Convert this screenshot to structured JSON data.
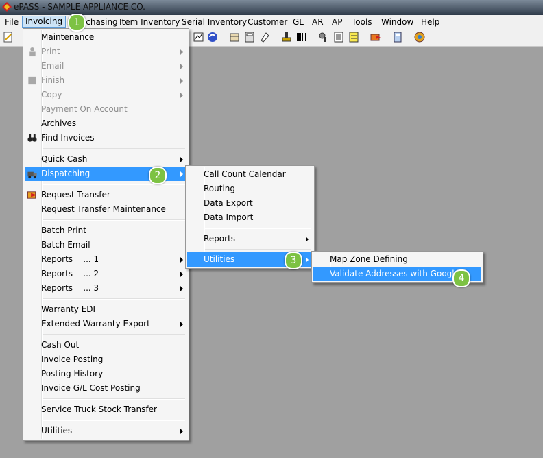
{
  "window": {
    "title": "ePASS  -  SAMPLE APPLIANCE CO."
  },
  "menubar": [
    "File",
    "Invoicing",
    "Purchasing",
    "Item Inventory",
    "Serial Inventory",
    "Customer",
    "GL",
    "AR",
    "AP",
    "Tools",
    "Window",
    "Help"
  ],
  "invoicing_menu": {
    "items": [
      "Maintenance",
      "Print",
      "Email",
      "Finish",
      "Copy",
      "Payment On Account",
      "Archives",
      "Find Invoices",
      "Quick Cash",
      "Dispatching",
      "Request Transfer",
      "Request Transfer Maintenance",
      "Batch Print",
      "Batch Email",
      "Reports    ... 1",
      "Reports    ... 2",
      "Reports    ... 3",
      "Warranty EDI",
      "Extended Warranty Export",
      "Cash Out",
      "Invoice Posting",
      "Posting History",
      "Invoice G/L Cost Posting",
      "Service Truck Stock Transfer",
      "Utilities"
    ]
  },
  "dispatching_menu": {
    "items": [
      "Call Count Calendar",
      "Routing",
      "Data Export",
      "Data Import",
      "Reports",
      "Utilities"
    ]
  },
  "utilities_menu": {
    "items": [
      "Map Zone Defining",
      "Validate Addresses with Google"
    ]
  },
  "badges": [
    "1",
    "2",
    "3",
    "4"
  ],
  "colors": {
    "highlight": "#3399ff",
    "badge": "#7dc243",
    "desktop": "#a0a0a0"
  }
}
